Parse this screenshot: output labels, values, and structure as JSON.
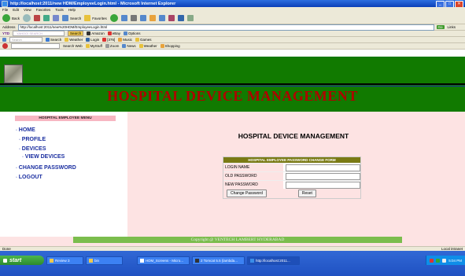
{
  "window": {
    "title": "http://localhost:2011/new HDM/EmployeeLogin.html - Microsoft Internet Explorer",
    "buttons": [
      "_",
      "□",
      "✕"
    ]
  },
  "menubar": [
    "File",
    "Edit",
    "View",
    "Favorites",
    "Tools",
    "Help"
  ],
  "toolbar": {
    "back": "Back",
    "search": "Search",
    "favorites": "Favorites"
  },
  "address": {
    "label": "Address",
    "value": "http://localhost:2011/new%20HDM/EmployeeLogin.html",
    "go": "Go",
    "links": "Links"
  },
  "yahoo_bar": {
    "name": "YTD",
    "search_placeholder": "YAHOO! SEARCH",
    "search_btn": "Search",
    "items": [
      "Amazon",
      "eBay",
      "Options"
    ]
  },
  "msn_bar": {
    "search_placeholder": "Search",
    "items": [
      "Search",
      "Weather",
      "Login",
      "[376]",
      "Music",
      "Games"
    ]
  },
  "ask_bar": {
    "items": [
      "Search Web",
      "MyStuff",
      "Zoom",
      "News",
      "Weather",
      "Shopping"
    ]
  },
  "page": {
    "banner": "HOSPITAL DEVICE MANAGEMENT",
    "menu_title": "HOSPITAL EMPLOYEE MENU",
    "menu": [
      {
        "label": "HOME"
      },
      {
        "label": "PROFILE"
      },
      {
        "label": "DEVICES"
      },
      {
        "label": "VIEW DEVICES"
      },
      {
        "label": "CHANGE PASSWORD"
      },
      {
        "label": "LOGOUT"
      }
    ],
    "content_title": "HOSPITAL DEVICE MANAGEMENT",
    "form": {
      "heading": "HOSPITAL EMPLOYEE PASSWORD CHANGE FORM",
      "fields": [
        {
          "label": "LOGIN NAME",
          "value": ""
        },
        {
          "label": "OLD PASSWORD",
          "value": ""
        },
        {
          "label": "NEW PASSWORD",
          "value": ""
        }
      ],
      "submit": "Change Password",
      "reset": "Reset"
    },
    "footer": "Copyright @ VENTECH LAMBERT HYDERABAD"
  },
  "status": {
    "left": "Done",
    "right": "Local intranet"
  },
  "taskbar": {
    "start": "start",
    "tasks": [
      "Review 3",
      "bin",
      "HDM_Screens - Micro...",
      "2 Tomcat 5.5 (lambda...",
      "http://localhost:2011..."
    ],
    "clock": "5:04 PM"
  },
  "colors": {
    "header_green": "#117a00",
    "banner_red": "#b00000",
    "panel_pink": "#fde3e3",
    "menu_link": "#1a2ea0",
    "form_head": "#7a7a14",
    "footer_green": "#7bbd4d"
  }
}
